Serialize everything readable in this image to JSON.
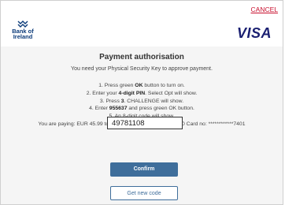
{
  "header": {
    "cancel_label": "CANCEL",
    "bank_name_line1": "Bank of",
    "bank_name_line2": "Ireland",
    "card_brand": "VISA"
  },
  "main": {
    "title": "Payment authorisation",
    "subtitle": "You need your Physical Security Key to approve payment.",
    "steps": {
      "s1_pre": "1. Press green ",
      "s1_bold": "OK",
      "s1_post": " button to turn on.",
      "s2_pre": "2. Enter your ",
      "s2_bold": "4-digit PIN",
      "s2_post": ". Select Opt will show.",
      "s3_pre": "3. Press ",
      "s3_bold": "3",
      "s3_post": ". CHALLENGE will show.",
      "s4_pre": "4. Enter ",
      "s4_bold": "955637",
      "s4_post": " and press green OK button.",
      "s5": "5. An 8-digit code will show."
    },
    "paying_text": "You are paying: EUR 45.99 to GOLFSTORE 3DS on 01/12/20 Card no: ************7401",
    "code_input_value": "49781108",
    "confirm_label": "Confirm",
    "new_code_label": "Get new code"
  },
  "colors": {
    "cancel": "#c8102e",
    "visa": "#1a1f71",
    "bank_blue": "#0b3b7a",
    "button": "#3f6e9b"
  }
}
